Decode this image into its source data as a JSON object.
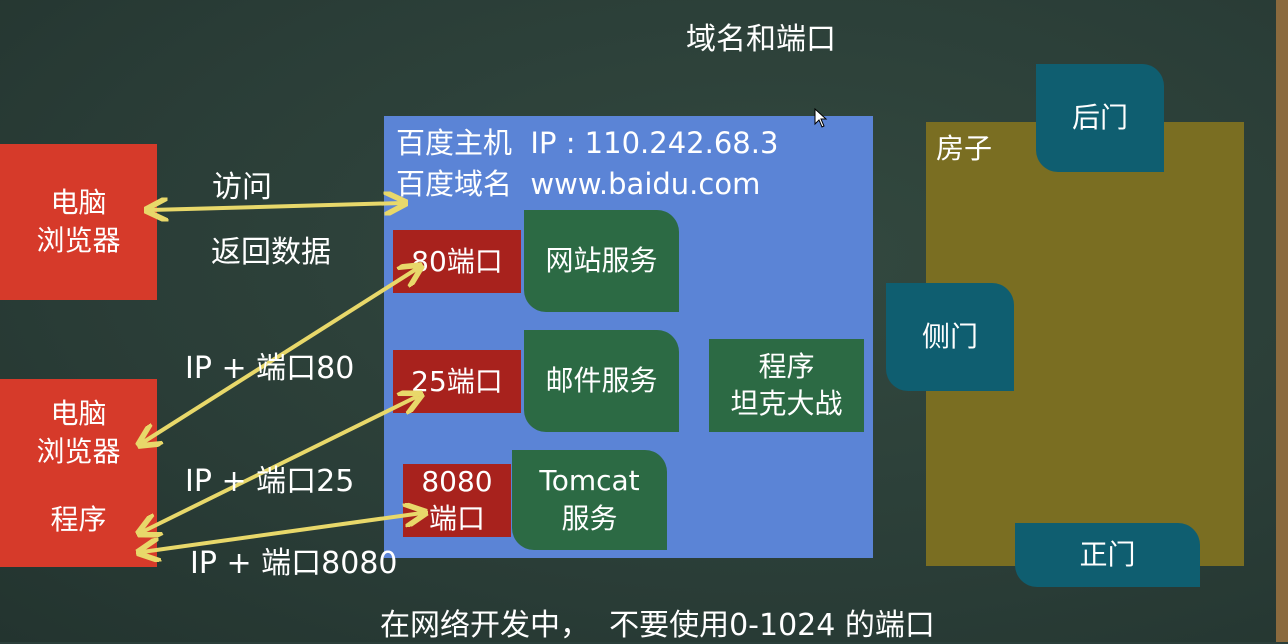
{
  "title": "域名和端口",
  "left": {
    "pc_browser_top": "电脑\n浏览器",
    "pc_browser_bottom": "电脑\n浏览器",
    "program": "程序"
  },
  "arrows": {
    "visit": "访问",
    "return_data": "返回数据",
    "ip_port_80": "IP + 端口80",
    "ip_port_25": "IP + 端口25",
    "ip_port_8080": "IP + 端口8080"
  },
  "host": {
    "ip_line": "百度主机  IP : 110.242.68.3",
    "domain_line": "百度域名  www.baidu.com",
    "port_80": "80端口",
    "port_25": "25端口",
    "port_8080": "8080\n端口",
    "web_service": "网站服务",
    "mail_service": "邮件服务",
    "tomcat_service": "Tomcat\n服务",
    "program_tank": "程序\n坦克大战"
  },
  "house": {
    "label": "房子",
    "back_door": "后门",
    "side_door": "侧门",
    "front_door": "正门"
  },
  "footer_note": "在网络开发中，  不要使用0-1024 的端口",
  "colors": {
    "board": "#2b3f3a",
    "host_bg": "#5b84d6",
    "house_bg": "#7a6e22",
    "red": "#d63a2a",
    "dark_red": "#a8221d",
    "green": "#2c6a44",
    "teal": "#0f5e70",
    "arrow": "#e8d86a"
  }
}
